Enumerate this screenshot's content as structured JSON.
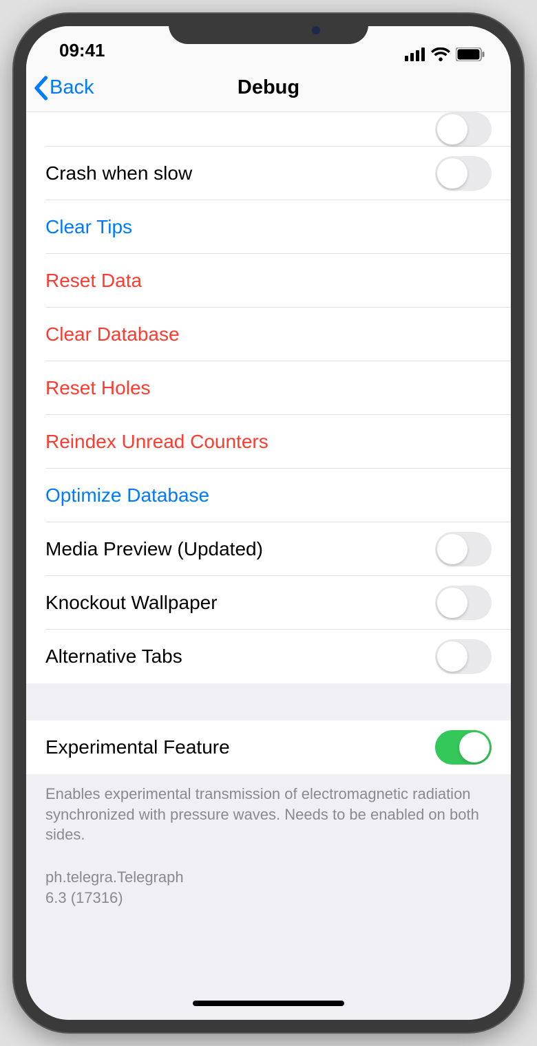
{
  "status": {
    "time": "09:41"
  },
  "nav": {
    "back": "Back",
    "title": "Debug"
  },
  "rows": {
    "crash_when_slow": "Crash when slow",
    "clear_tips": "Clear Tips",
    "reset_data": "Reset Data",
    "clear_database": "Clear Database",
    "reset_holes": "Reset Holes",
    "reindex_unread": "Reindex Unread Counters",
    "optimize_db": "Optimize Database",
    "media_preview": "Media Preview (Updated)",
    "knockout_wallpaper": "Knockout Wallpaper",
    "alternative_tabs": "Alternative Tabs",
    "experimental_feature": "Experimental Feature"
  },
  "switch_state": {
    "crash_when_slow": false,
    "media_preview": false,
    "knockout_wallpaper": false,
    "alternative_tabs": false,
    "experimental_feature": true
  },
  "footer": {
    "experimental_desc": "Enables experimental transmission of electromagnetic radiation synchronized with pressure waves. Needs to be enabled on both sides."
  },
  "version": {
    "bundle": "ph.telegra.Telegraph",
    "build": "6.3 (17316)"
  }
}
